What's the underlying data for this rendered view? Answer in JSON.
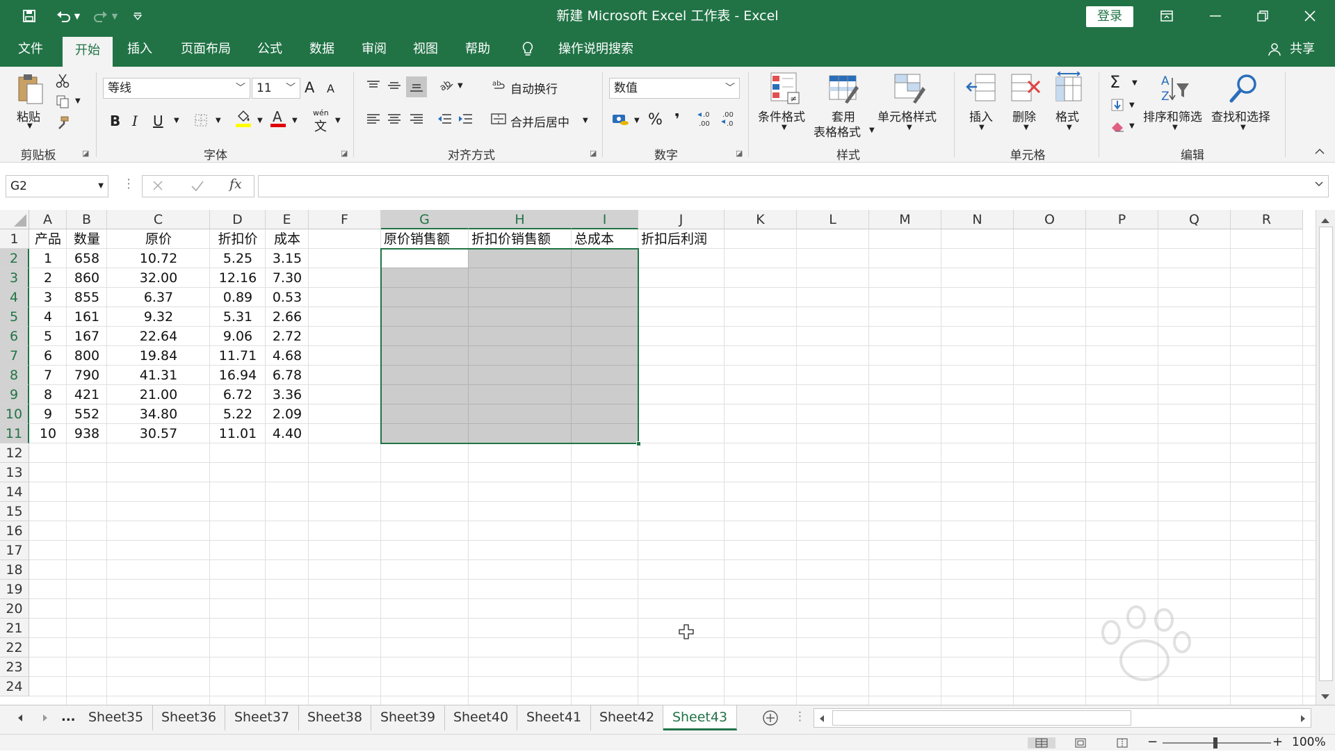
{
  "window": {
    "title": "新建 Microsoft Excel 工作表  -  Excel",
    "login_label": "登录"
  },
  "tabs": [
    "文件",
    "开始",
    "插入",
    "页面布局",
    "公式",
    "数据",
    "审阅",
    "视图",
    "帮助",
    "操作说明搜索",
    "共享"
  ],
  "ribbon": {
    "clipboard": {
      "paste": "粘贴",
      "group": "剪贴板"
    },
    "font": {
      "name": "等线",
      "size": "11",
      "bold": "B",
      "italic": "I",
      "underline": "U",
      "group": "字体",
      "grow": "A",
      "shrink": "A",
      "phonetic_top": "wén",
      "phonetic_bottom": "文"
    },
    "alignment": {
      "wrap": "自动换行",
      "merge": "合并后居中",
      "group": "对齐方式"
    },
    "number": {
      "format": "数值",
      "percent": "%",
      "comma": "❜",
      "inc_decimal": "←.0\n.00",
      "group": "数字"
    },
    "styles": {
      "conditional": "条件格式",
      "table_l1": "套用",
      "table_l2": "表格格式",
      "cell_styles": "单元格样式",
      "group": "样式"
    },
    "cells": {
      "insert": "插入",
      "delete": "删除",
      "format": "格式",
      "group": "单元格"
    },
    "editing": {
      "sort": "排序和筛选",
      "find": "查找和选择",
      "group": "编辑",
      "sigma": "Σ"
    }
  },
  "formula_bar": {
    "name_box": "G2",
    "fx": "fx",
    "value": ""
  },
  "columns": [
    "A",
    "B",
    "C",
    "D",
    "E",
    "F",
    "G",
    "H",
    "I",
    "J",
    "K",
    "L",
    "M",
    "N",
    "O",
    "P",
    "Q",
    "R"
  ],
  "rows": [
    "1",
    "2",
    "3",
    "4",
    "5",
    "6",
    "7",
    "8",
    "9",
    "10",
    "11",
    "12",
    "13",
    "14",
    "15",
    "16",
    "17",
    "18",
    "19",
    "20",
    "21",
    "22",
    "23",
    "24"
  ],
  "headers": [
    "产品",
    "数量",
    "原价",
    "折扣价",
    "成本",
    "原价销售额",
    "折扣价销售额",
    "总成本",
    "折扣后利润"
  ],
  "data": [
    [
      "1",
      "658",
      "10.72",
      "5.25",
      "3.15"
    ],
    [
      "2",
      "860",
      "32.00",
      "12.16",
      "7.30"
    ],
    [
      "3",
      "855",
      "6.37",
      "0.89",
      "0.53"
    ],
    [
      "4",
      "161",
      "9.32",
      "5.31",
      "2.66"
    ],
    [
      "5",
      "167",
      "22.64",
      "9.06",
      "2.72"
    ],
    [
      "6",
      "800",
      "19.84",
      "11.71",
      "4.68"
    ],
    [
      "7",
      "790",
      "41.31",
      "16.94",
      "6.78"
    ],
    [
      "8",
      "421",
      "21.00",
      "6.72",
      "3.36"
    ],
    [
      "9",
      "552",
      "34.80",
      "5.22",
      "2.09"
    ],
    [
      "10",
      "938",
      "30.57",
      "11.01",
      "4.40"
    ]
  ],
  "sheets": [
    "Sheet35",
    "Sheet36",
    "Sheet37",
    "Sheet38",
    "Sheet39",
    "Sheet40",
    "Sheet41",
    "Sheet42",
    "Sheet43"
  ],
  "active_sheet": "Sheet43",
  "sheet_nav_more": "...",
  "status": {
    "zoom": "100%"
  },
  "colors": {
    "accent": "#217346"
  }
}
